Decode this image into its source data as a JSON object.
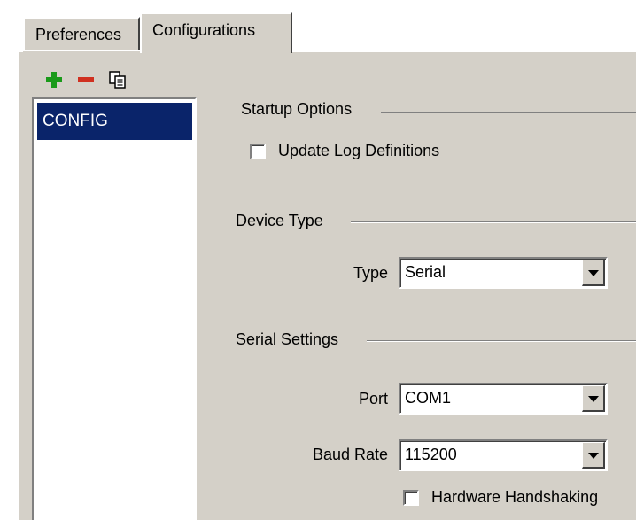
{
  "tabs": [
    {
      "label": "Preferences",
      "active": false
    },
    {
      "label": "Configurations",
      "active": true
    }
  ],
  "config_list": {
    "toolbar": {
      "add_icon": "plus-icon",
      "remove_icon": "minus-icon",
      "copy_icon": "copy-icon"
    },
    "items": [
      "CONFIG"
    ],
    "selected": "CONFIG"
  },
  "startup_options": {
    "title": "Startup Options",
    "update_log_definitions": {
      "label": "Update Log Definitions",
      "checked": false
    }
  },
  "device_type": {
    "title": "Device Type",
    "type_label": "Type",
    "type_value": "Serial"
  },
  "serial_settings": {
    "title": "Serial Settings",
    "port_label": "Port",
    "port_value": "COM1",
    "baud_label": "Baud Rate",
    "baud_value": "115200",
    "hardware_handshaking": {
      "label": "Hardware Handshaking",
      "checked": false
    }
  },
  "colors": {
    "panel": "#d4d0c8",
    "selection": "#0a246a",
    "add": "#1a9a1a",
    "remove": "#d03020"
  }
}
